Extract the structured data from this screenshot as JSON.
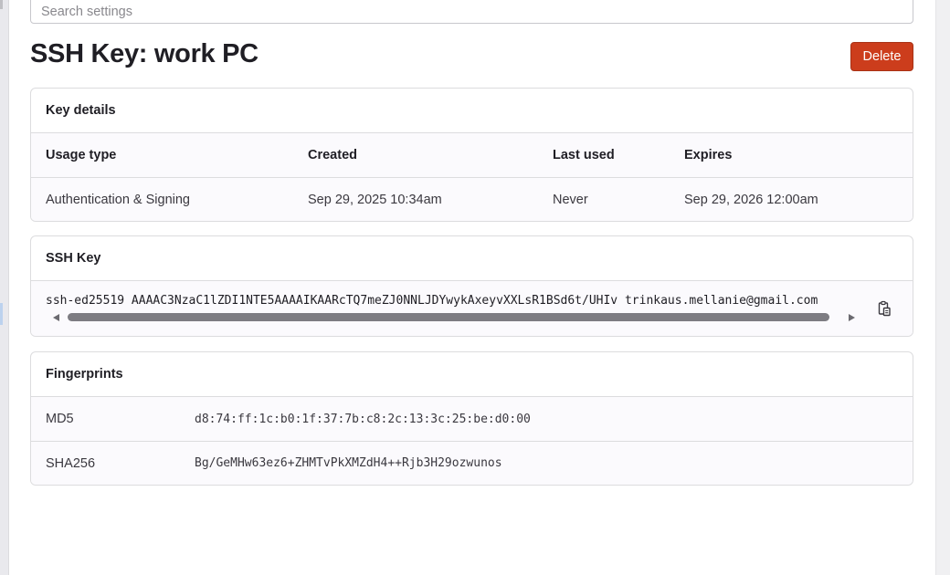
{
  "search": {
    "placeholder": "Search settings"
  },
  "page": {
    "title": "SSH Key: work PC",
    "delete_label": "Delete"
  },
  "key_details": {
    "heading": "Key details",
    "columns": [
      "Usage type",
      "Created",
      "Last used",
      "Expires"
    ],
    "values": [
      "Authentication & Signing",
      "Sep 29, 2025 10:34am",
      "Never",
      "Sep 29, 2026 12:00am"
    ]
  },
  "ssh_key": {
    "heading": "SSH Key",
    "value": "ssh-ed25519 AAAAC3NzaC1lZDI1NTE5AAAAIKAARcTQ7meZJ0NNLJDYwykAxeyvXXLsR1BSd6t/UHIv trinkaus.mellanie@gmail.com",
    "copy_icon": "clipboard-copy-icon"
  },
  "fingerprints": {
    "heading": "Fingerprints",
    "rows": [
      {
        "label": "MD5",
        "value": "d8:74:ff:1c:b0:1f:37:7b:c8:2c:13:3c:25:be:d0:00"
      },
      {
        "label": "SHA256",
        "value": "Bg/GeMHw63ez6+ZHMTvPkXMZdH4++Rjb3H29ozwunos"
      }
    ]
  },
  "colors": {
    "danger": "#cc3d1c",
    "border": "#dcdcde",
    "row_bg": "#fbfafd",
    "text": "#1f1e24"
  }
}
